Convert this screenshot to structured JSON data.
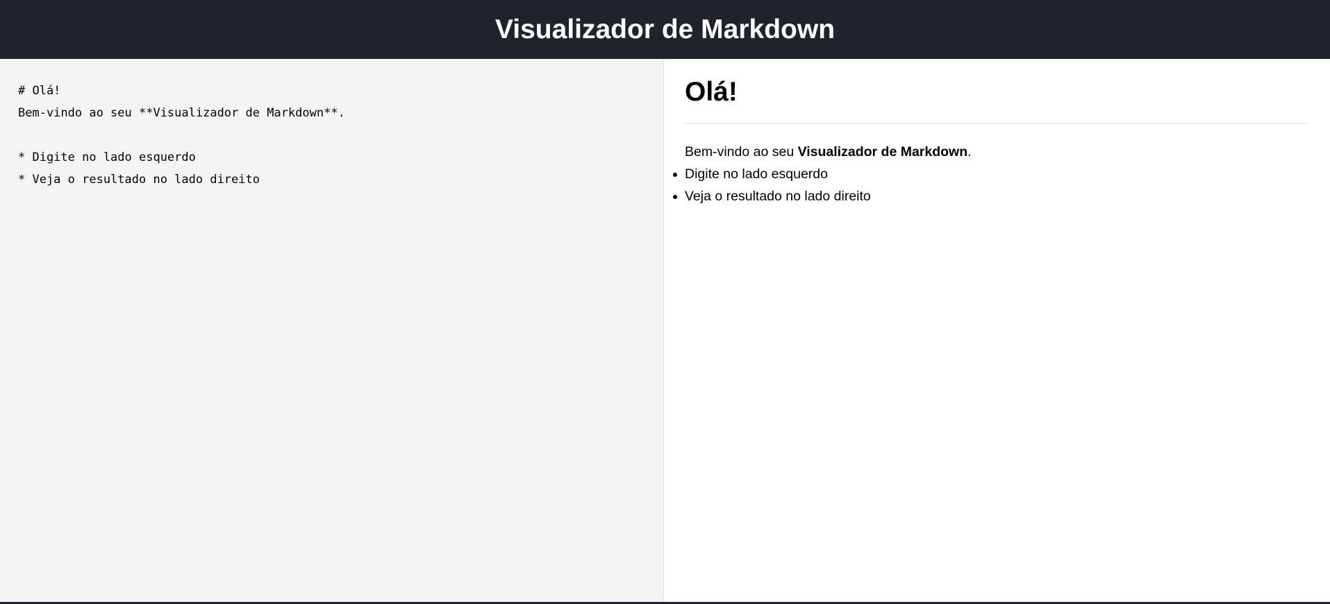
{
  "header": {
    "title": "Visualizador de Markdown"
  },
  "editor": {
    "value": "# Olá!\nBem-vindo ao seu **Visualizador de Markdown**.\n\n* Digite no lado esquerdo\n* Veja o resultado no lado direito"
  },
  "preview": {
    "heading": "Olá!",
    "paragraph_prefix": "Bem-vindo ao seu ",
    "paragraph_bold": "Visualizador de Markdown",
    "paragraph_suffix": ".",
    "list": [
      "Digite no lado esquerdo",
      "Veja o resultado no lado direito"
    ]
  }
}
